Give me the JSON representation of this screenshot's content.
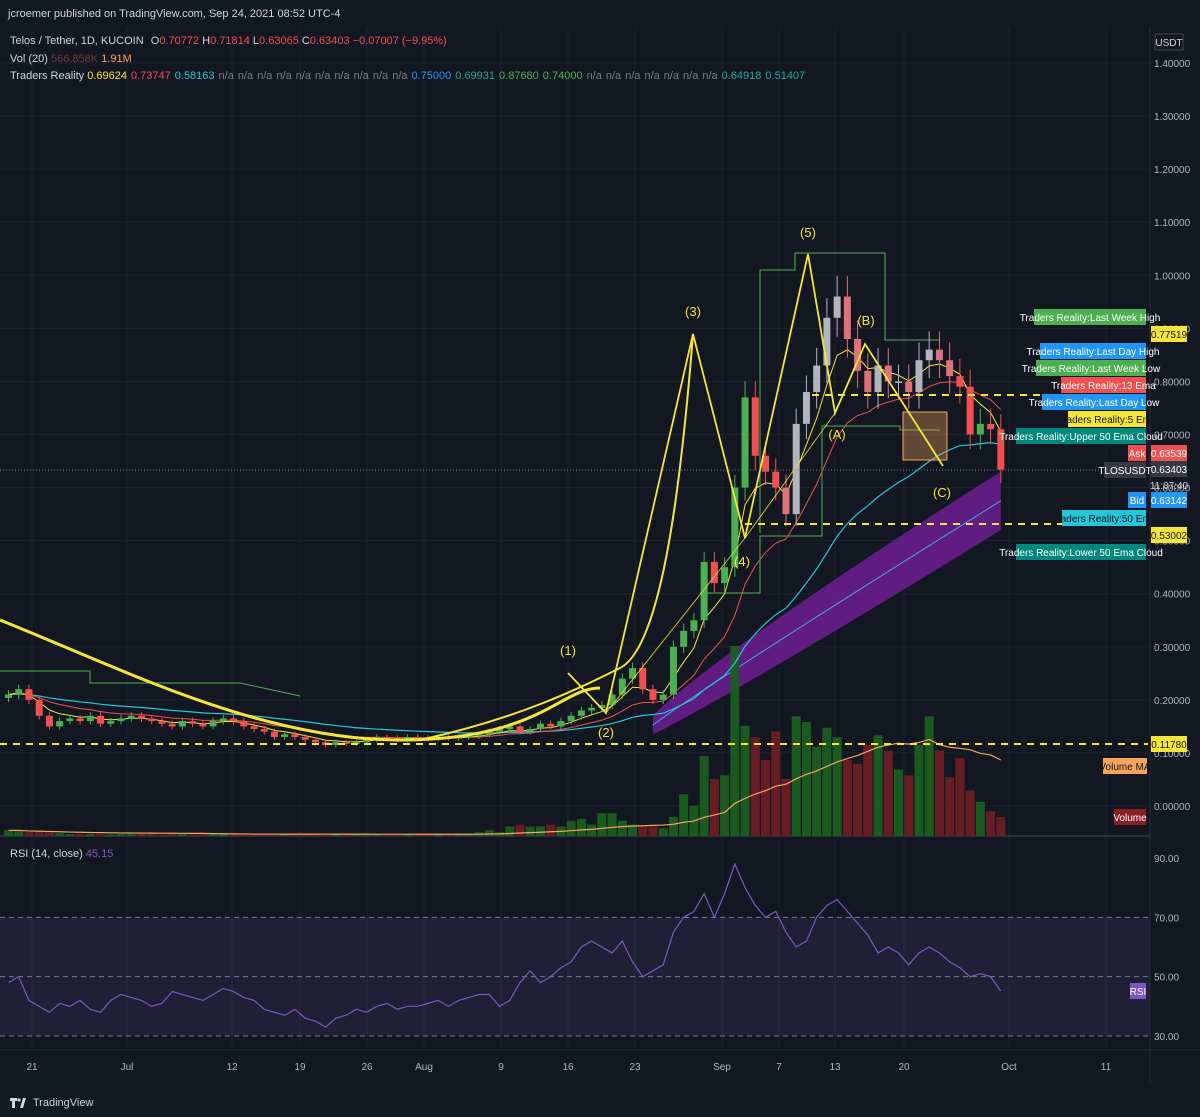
{
  "header": {
    "publisher": "jcroemer published on TradingView.com, Sep 24, 2021 08:52 UTC-4"
  },
  "legend": {
    "symbol": "Telos / Tether, 1D, KUCOIN",
    "ohlc": {
      "o_label": "O",
      "o": "0.70772",
      "h_label": "H",
      "h": "0.71814",
      "l_label": "L",
      "l": "0.63065",
      "c_label": "C",
      "c": "0.63403",
      "change": "−0.07007 (−9.95%)"
    },
    "vol_label": "Vol (20)",
    "vol_value1": "566.858K",
    "vol_value2": "1.91M",
    "tr_label": "Traders Reality",
    "tr_values": [
      "0.69624",
      "0.73747",
      "0.58163",
      "n/a",
      "n/a",
      "n/a",
      "n/a",
      "n/a",
      "n/a",
      "n/a",
      "n/a",
      "n/a",
      "n/a",
      "0.75000",
      "0.69931",
      "0.87680",
      "0.74000",
      "n/a",
      "n/a",
      "n/a",
      "n/a",
      "n/a",
      "n/a",
      "n/a",
      "0.64918",
      "0.51407"
    ],
    "tr_colors": [
      "#f5e53b",
      "#f0504f",
      "#26c6da",
      "#787b86",
      "#787b86",
      "#787b86",
      "#787b86",
      "#787b86",
      "#787b86",
      "#787b86",
      "#787b86",
      "#787b86",
      "#787b86",
      "#2196f3",
      "#26a69a",
      "#4caf50",
      "#4caf50",
      "#787b86",
      "#787b86",
      "#787b86",
      "#787b86",
      "#787b86",
      "#787b86",
      "#787b86",
      "#26a69a",
      "#26a69a"
    ],
    "rsi_label": "RSI (14, close)",
    "rsi_value": "45.15"
  },
  "axis": {
    "currency": "USDT",
    "price_ticks": [
      "1.40000",
      "1.30000",
      "1.20000",
      "1.10000",
      "1.00000",
      "0.90000",
      "0.80000",
      "0.70000",
      "0.60000",
      "0.50000",
      "0.40000",
      "0.30000",
      "0.20000",
      "0.10000",
      "0.00000"
    ],
    "rsi_ticks": [
      "90.00",
      "70.00",
      "50.00",
      "30.00"
    ],
    "time_ticks": [
      "21",
      "Jul",
      "12",
      "19",
      "26",
      "Aug",
      "9",
      "16",
      "23",
      "Sep",
      "7",
      "13",
      "20",
      "Oct",
      "11"
    ]
  },
  "labels": {
    "last_week_high": "Traders Reality:Last Week High",
    "last_day_high": "Traders Reality:Last Day High",
    "last_week_low": "Traders Reality:Last Week Low",
    "ema13": "Traders Reality:13 Ema",
    "last_day_low": "Traders Reality:Last Day Low",
    "ema5": "Traders Reality:5 Ema",
    "upper_cloud": "Traders Reality:Upper 50 Ema Cloud",
    "ema50": "Traders Reality:50 Ema",
    "lower_cloud": "Traders Reality:Lower 50 Ema Cloud",
    "volume_ma": "Volume MA",
    "volume": "Volume",
    "rsi": "RSI",
    "ask": "Ask",
    "bid": "Bid",
    "ticker": "TLOSUSDT",
    "countdown": "11:07:40"
  },
  "price_labels": {
    "level_high": "0.77519",
    "ask": "0.63539",
    "last": "0.63403",
    "bid": "0.63142",
    "level_mid": "0.53002",
    "level_low": "0.11780"
  },
  "waves": [
    "(1)",
    "(2)",
    "(3)",
    "(4)",
    "(5)",
    "(A)",
    "(B)",
    "(C)"
  ],
  "footer": {
    "brand": "TradingView"
  },
  "colors": {
    "up": "#4caf50",
    "down": "#f0504f",
    "yellow": "#f5e53b",
    "cloud": "#7b1fa2",
    "rsi": "#7e57c2",
    "bg": "#131722"
  },
  "chart_data": {
    "type": "candlestick",
    "symbol": "TLOS/USDT",
    "interval": "1D",
    "ylim": [
      0.0,
      1.42
    ],
    "dates": [
      "06-19",
      "06-20",
      "06-21",
      "06-22",
      "06-23",
      "06-24",
      "06-25",
      "06-26",
      "06-27",
      "06-28",
      "06-29",
      "06-30",
      "07-01",
      "07-02",
      "07-03",
      "07-04",
      "07-05",
      "07-06",
      "07-07",
      "07-08",
      "07-09",
      "07-10",
      "07-11",
      "07-12",
      "07-13",
      "07-14",
      "07-15",
      "07-16",
      "07-17",
      "07-18",
      "07-19",
      "07-20",
      "07-21",
      "07-22",
      "07-23",
      "07-24",
      "07-25",
      "07-26",
      "07-27",
      "07-28",
      "07-29",
      "07-30",
      "07-31",
      "08-01",
      "08-02",
      "08-03",
      "08-04",
      "08-05",
      "08-06",
      "08-07",
      "08-08",
      "08-09",
      "08-10",
      "08-11",
      "08-12",
      "08-13",
      "08-14",
      "08-15",
      "08-16",
      "08-17",
      "08-18",
      "08-19",
      "08-20",
      "08-21",
      "08-22",
      "08-23",
      "08-24",
      "08-25",
      "08-26",
      "08-27",
      "08-28",
      "08-29",
      "08-30",
      "08-31",
      "09-01",
      "09-02",
      "09-03",
      "09-04",
      "09-05",
      "09-06",
      "09-07",
      "09-08",
      "09-09",
      "09-10",
      "09-11",
      "09-12",
      "09-13",
      "09-14",
      "09-15",
      "09-16",
      "09-17",
      "09-18",
      "09-19",
      "09-20",
      "09-21",
      "09-22",
      "09-23",
      "09-24"
    ],
    "close": [
      0.21,
      0.22,
      0.2,
      0.17,
      0.15,
      0.16,
      0.165,
      0.16,
      0.17,
      0.155,
      0.16,
      0.165,
      0.17,
      0.165,
      0.16,
      0.155,
      0.15,
      0.16,
      0.155,
      0.15,
      0.16,
      0.165,
      0.16,
      0.15,
      0.145,
      0.14,
      0.13,
      0.135,
      0.13,
      0.125,
      0.12,
      0.115,
      0.12,
      0.118,
      0.12,
      0.125,
      0.13,
      0.128,
      0.125,
      0.13,
      0.128,
      0.127,
      0.13,
      0.128,
      0.13,
      0.132,
      0.135,
      0.14,
      0.145,
      0.15,
      0.14,
      0.145,
      0.155,
      0.15,
      0.16,
      0.17,
      0.18,
      0.185,
      0.19,
      0.21,
      0.24,
      0.26,
      0.22,
      0.2,
      0.21,
      0.3,
      0.33,
      0.35,
      0.46,
      0.42,
      0.45,
      0.6,
      0.77,
      0.66,
      0.63,
      0.6,
      0.55,
      0.72,
      0.78,
      0.83,
      0.92,
      0.96,
      0.88,
      0.82,
      0.78,
      0.83,
      0.8,
      0.8,
      0.78,
      0.84,
      0.86,
      0.84,
      0.81,
      0.79,
      0.7,
      0.72,
      0.71,
      0.634
    ],
    "volume_max_rel": 1.0,
    "rsi": [
      48,
      50,
      42,
      40,
      38,
      41,
      40,
      42,
      39,
      38,
      42,
      44,
      43,
      42,
      40,
      41,
      45,
      44,
      43,
      42,
      44,
      46,
      45,
      43,
      42,
      39,
      38,
      37,
      39,
      36,
      35,
      33,
      36,
      37,
      39,
      38,
      40,
      41,
      39,
      40,
      40,
      41,
      42,
      40,
      42,
      43,
      44,
      44,
      40,
      42,
      48,
      52,
      48,
      50,
      53,
      55,
      60,
      62,
      60,
      58,
      62,
      55,
      50,
      52,
      54,
      65,
      70,
      72,
      78,
      70,
      78,
      88,
      80,
      74,
      70,
      72,
      65,
      60,
      62,
      70,
      74,
      76,
      72,
      68,
      64,
      58,
      60,
      58,
      54,
      58,
      60,
      58,
      55,
      53,
      50,
      51,
      50,
      45.15
    ]
  }
}
